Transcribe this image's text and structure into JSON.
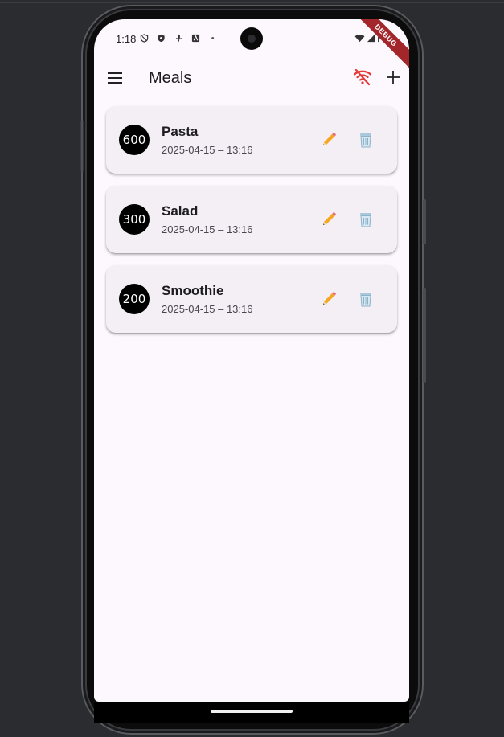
{
  "status_bar": {
    "time": "1:18"
  },
  "debug_banner": "DEBUG",
  "app_bar": {
    "title": "Meals"
  },
  "meals": [
    {
      "calories": "600",
      "name": "Pasta",
      "datetime": "2025-04-15 – 13:16"
    },
    {
      "calories": "300",
      "name": "Salad",
      "datetime": "2025-04-15 – 13:16"
    },
    {
      "calories": "200",
      "name": "Smoothie",
      "datetime": "2025-04-15 – 13:16"
    }
  ],
  "colors": {
    "screen_background": "#fdf7fe",
    "card_background": "#f4eff4",
    "avatar_background": "#000000",
    "offline_icon": "#e53935",
    "debug_banner": "#a3262a"
  },
  "icons": {
    "menu": "hamburger-menu-icon",
    "offline": "wifi-off-icon",
    "add": "plus-icon",
    "edit": "pencil-icon",
    "delete": "trash-can-icon"
  }
}
